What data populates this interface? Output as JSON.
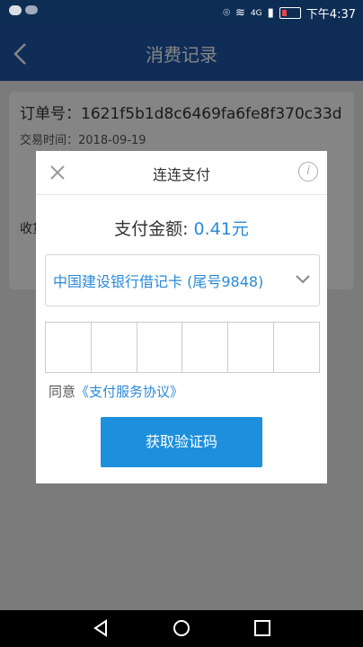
{
  "status_bar": {
    "time": "下午4:37",
    "carrier": "4G"
  },
  "app_bar": {
    "title": "消费记录"
  },
  "record": {
    "order_label": "订单号：",
    "order_number": "1621f5b1d8c6469fa6fe8f370c33d...",
    "time_label": "交易时间：",
    "time_value": "2018-09-19",
    "payee_label": "收货"
  },
  "dialog": {
    "title": "连连支付",
    "info_icon": "i",
    "amount_label": "支付金额:",
    "amount_value": "0.41元",
    "bank_card": "中国建设银行借记卡 (尾号9848)",
    "agree_prefix": "同意",
    "agreement_link": "《支付服务协议》",
    "submit_label": "获取验证码"
  }
}
